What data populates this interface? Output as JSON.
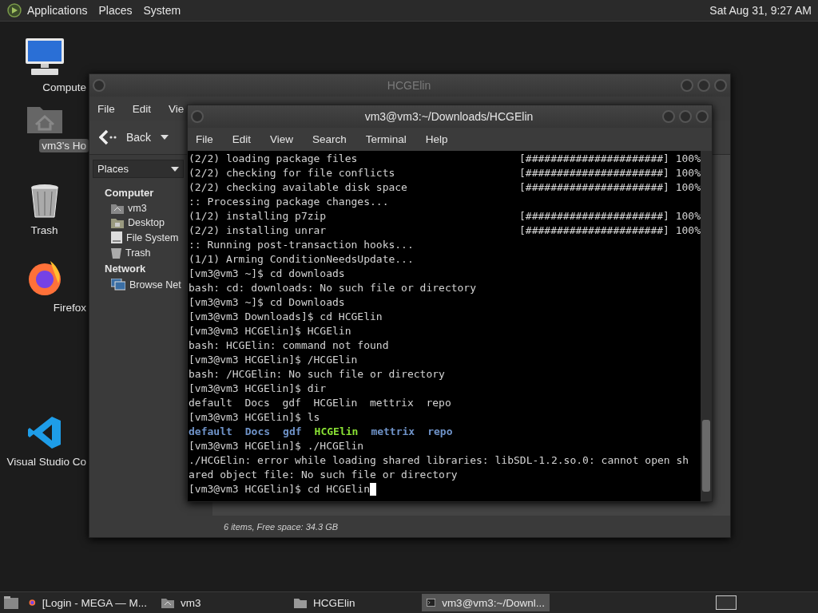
{
  "top_panel": {
    "menus": [
      "Applications",
      "Places",
      "System"
    ],
    "clock": "Sat Aug 31, 9:27 AM"
  },
  "desktop_icons": [
    {
      "label": "Compute",
      "kind": "computer",
      "selected": false
    },
    {
      "label": "vm3's Ho",
      "kind": "home",
      "selected": true
    },
    {
      "label": "Trash",
      "kind": "trash",
      "selected": false
    },
    {
      "label": "Firefox",
      "kind": "browser",
      "selected": false
    },
    {
      "label": "Visual Studio Co",
      "kind": "editor",
      "selected": false
    }
  ],
  "file_manager": {
    "title": "HCGElin",
    "menus": [
      "File",
      "Edit",
      "Vie"
    ],
    "back_label": "Back",
    "places_label": "Places",
    "sections": [
      {
        "heading": "Computer",
        "items": [
          {
            "label": "vm3",
            "kind": "home"
          },
          {
            "label": "Desktop",
            "kind": "desktop"
          },
          {
            "label": "File System",
            "kind": "drive"
          },
          {
            "label": "Trash",
            "kind": "trash"
          }
        ]
      },
      {
        "heading": "Network",
        "items": [
          {
            "label": "Browse Net",
            "kind": "network"
          }
        ]
      }
    ],
    "status": "6 items, Free space: 34.3 GB"
  },
  "terminal": {
    "title": "vm3@vm3:~/Downloads/HCGElin",
    "menus": [
      "File",
      "Edit",
      "View",
      "Search",
      "Terminal",
      "Help"
    ],
    "cursor": true,
    "lines": [
      {
        "kind": "progress",
        "text": "(2/2) loading package files",
        "bar": "[######################] 100%"
      },
      {
        "kind": "progress",
        "text": "(2/2) checking for file conflicts",
        "bar": "[######################] 100%"
      },
      {
        "kind": "progress",
        "text": "(2/2) checking available disk space",
        "bar": "[######################] 100%"
      },
      {
        "kind": "output",
        "text": ":: Processing package changes..."
      },
      {
        "kind": "progress",
        "text": "(1/2) installing p7zip",
        "bar": "[######################] 100%"
      },
      {
        "kind": "progress",
        "text": "(2/2) installing unrar",
        "bar": "[######################] 100%"
      },
      {
        "kind": "output",
        "text": ":: Running post-transaction hooks..."
      },
      {
        "kind": "output",
        "text": "(1/1) Arming ConditionNeedsUpdate..."
      },
      {
        "kind": "output",
        "text": "[vm3@vm3 ~]$ cd downloads"
      },
      {
        "kind": "output",
        "text": "bash: cd: downloads: No such file or directory"
      },
      {
        "kind": "output",
        "text": "[vm3@vm3 ~]$ cd Downloads"
      },
      {
        "kind": "output",
        "text": "[vm3@vm3 Downloads]$ cd HCGElin"
      },
      {
        "kind": "output",
        "text": "[vm3@vm3 HCGElin]$ HCGElin"
      },
      {
        "kind": "output",
        "text": "bash: HCGElin: command not found"
      },
      {
        "kind": "output",
        "text": "[vm3@vm3 HCGElin]$ /HCGElin"
      },
      {
        "kind": "output",
        "text": "bash: /HCGElin: No such file or directory"
      },
      {
        "kind": "output",
        "text": "[vm3@vm3 HCGElin]$ dir"
      },
      {
        "kind": "output",
        "text": "default  Docs  gdf  HCGElin  mettrix  repo"
      },
      {
        "kind": "output",
        "text": "[vm3@vm3 HCGElin]$ ls"
      },
      {
        "kind": "listing",
        "items": [
          {
            "name": "default",
            "color": "#6f93c9"
          },
          {
            "name": "Docs",
            "color": "#6f93c9"
          },
          {
            "name": "gdf",
            "color": "#6f93c9"
          },
          {
            "name": "HCGElin",
            "color": "#8ae234"
          },
          {
            "name": "mettrix",
            "color": "#6f93c9"
          },
          {
            "name": "repo",
            "color": "#6f93c9"
          }
        ]
      },
      {
        "kind": "output",
        "text": "[vm3@vm3 HCGElin]$ ./HCGElin"
      },
      {
        "kind": "output",
        "text": "./HCGElin: error while loading shared libraries: libSDL-1.2.so.0: cannot open sh"
      },
      {
        "kind": "output",
        "text": "ared object file: No such file or directory"
      },
      {
        "kind": "output",
        "text": "[vm3@vm3 HCGElin]$ cd HCGElin"
      }
    ]
  },
  "taskbar": {
    "buttons": [
      {
        "label": "[Login - MEGA — M...",
        "kind": "browser",
        "selected": false
      },
      {
        "label": "vm3",
        "kind": "home",
        "selected": false
      },
      {
        "label": "HCGElin",
        "kind": "folder",
        "selected": false
      },
      {
        "label": "vm3@vm3:~/Downl...",
        "kind": "terminal",
        "selected": true
      }
    ]
  }
}
